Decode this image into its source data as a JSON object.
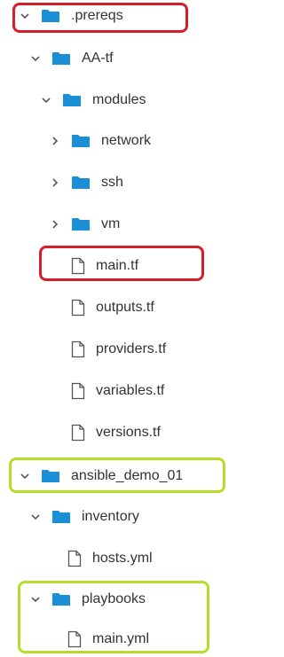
{
  "tree": [
    {
      "label": ".prereqs",
      "type": "folder",
      "state": "expanded",
      "depth": 0
    },
    {
      "label": "AA-tf",
      "type": "folder",
      "state": "expanded",
      "depth": 1
    },
    {
      "label": "modules",
      "type": "folder",
      "state": "expanded",
      "depth": 2
    },
    {
      "label": "network",
      "type": "folder",
      "state": "collapsed",
      "depth": 3
    },
    {
      "label": "ssh",
      "type": "folder",
      "state": "collapsed",
      "depth": 3
    },
    {
      "label": "vm",
      "type": "folder",
      "state": "collapsed",
      "depth": 3
    },
    {
      "label": "main.tf",
      "type": "file",
      "depth": 3
    },
    {
      "label": "outputs.tf",
      "type": "file",
      "depth": 3
    },
    {
      "label": "providers.tf",
      "type": "file",
      "depth": 3
    },
    {
      "label": "variables.tf",
      "type": "file",
      "depth": 3
    },
    {
      "label": "versions.tf",
      "type": "file",
      "depth": 3
    },
    {
      "label": "ansible_demo_01",
      "type": "folder",
      "state": "expanded",
      "depth": 0
    },
    {
      "label": "inventory",
      "type": "folder",
      "state": "expanded",
      "depth": 1
    },
    {
      "label": "hosts.yml",
      "type": "file",
      "depth": 2
    },
    {
      "label": "playbooks",
      "type": "folder",
      "state": "expanded",
      "depth": 1
    },
    {
      "label": "main.yml",
      "type": "file",
      "depth": 2
    }
  ],
  "colors": {
    "folder": "#1a8fd8",
    "highlight_red": "#d31f2b",
    "highlight_green": "#b4de2b"
  },
  "highlights": [
    {
      "color": "red",
      "covers": ".prereqs"
    },
    {
      "color": "red",
      "covers": "main.tf"
    },
    {
      "color": "green",
      "covers": "ansible_demo_01"
    },
    {
      "color": "green",
      "covers": "playbooks + main.yml"
    }
  ]
}
